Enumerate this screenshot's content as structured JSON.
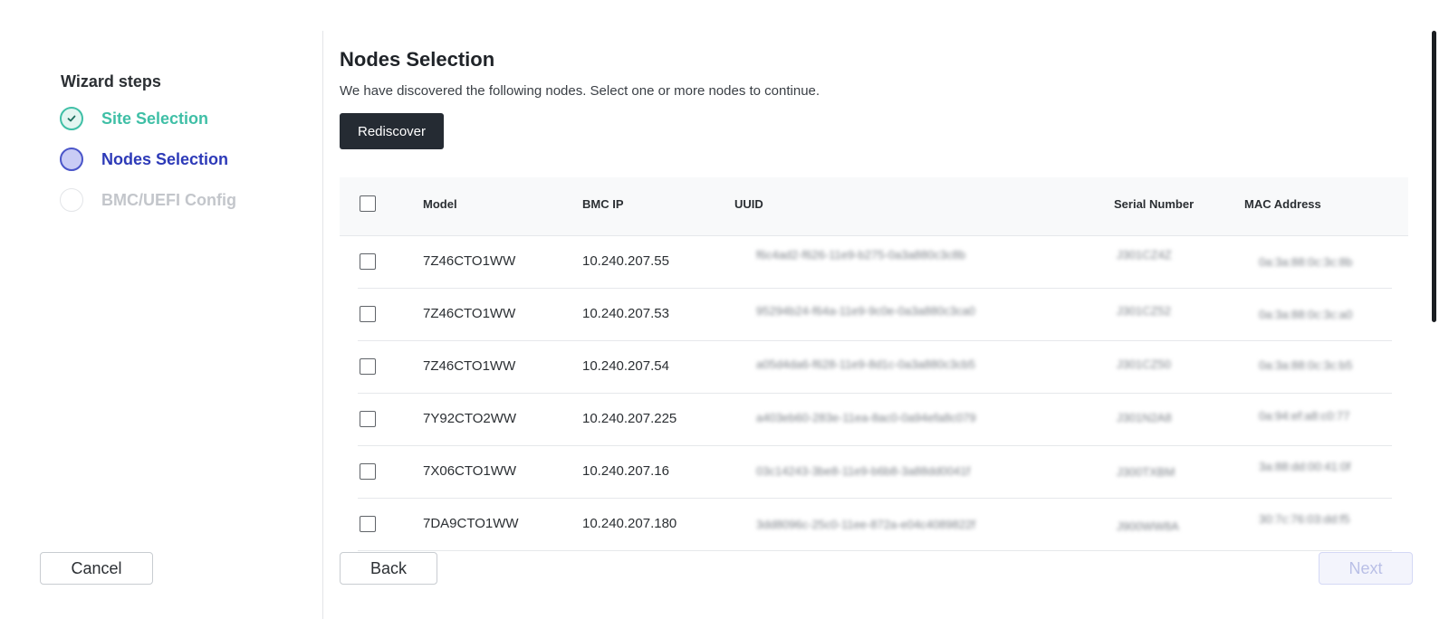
{
  "wizard": {
    "title": "Wizard steps",
    "steps": [
      {
        "label": "Site Selection",
        "status": "complete"
      },
      {
        "label": "Nodes Selection",
        "status": "current"
      },
      {
        "label": "BMC/UEFI Config",
        "status": "pending"
      }
    ]
  },
  "main": {
    "title": "Nodes Selection",
    "description": "We have discovered the following nodes. Select one or more nodes to continue.",
    "rediscover_label": "Rediscover"
  },
  "table": {
    "columns": [
      "Model",
      "BMC IP",
      "UUID",
      "Serial Number",
      "MAC Address"
    ],
    "rows": [
      {
        "model": "7Z46CTO1WW",
        "bmc_ip": "10.240.207.55",
        "uuid": "f6c4ad2-f626-11e9-b275-0a3a880c3c8b",
        "serial": "J301CZ4Z",
        "mac": "0a:3a:88:0c:3c:8b",
        "checked": false
      },
      {
        "model": "7Z46CTO1WW",
        "bmc_ip": "10.240.207.53",
        "uuid": "95294b24-f64a-11e9-9c0e-0a3a880c3ca0",
        "serial": "J301CZ52",
        "mac": "0a:3a:88:0c:3c:a0",
        "checked": false
      },
      {
        "model": "7Z46CTO1WW",
        "bmc_ip": "10.240.207.54",
        "uuid": "a05d4da6-f628-11e9-8d1c-0a3a880c3cb5",
        "serial": "J301CZ50",
        "mac": "0a:3a:88:0c:3c:b5",
        "checked": false
      },
      {
        "model": "7Y92CTO2WW",
        "bmc_ip": "10.240.207.225",
        "uuid": "a403eb60-283e-11ea-8ac0-0a94efa8c079",
        "serial": "J301N2A8",
        "mac": "0a:94:ef:a8:c0:77",
        "checked": false
      },
      {
        "model": "7X06CTO1WW",
        "bmc_ip": "10.240.207.16",
        "uuid": "03c14243-3be8-11e9-b6b8-3a88dd0041f",
        "serial": "J300TXBM",
        "mac": "3a:88:dd:00:41:0f",
        "checked": false
      },
      {
        "model": "7DA9CTO1WW",
        "bmc_ip": "10.240.207.180",
        "uuid": "3dd8096c-25c0-11ee-872a-e04c4089822f",
        "serial": "J900WW8A",
        "mac": "30:7c:76:03:dd:f5",
        "checked": false
      }
    ]
  },
  "footer": {
    "cancel_label": "Cancel",
    "back_label": "Back",
    "next_label": "Next"
  },
  "colors": {
    "step_complete": "#3fbfa6",
    "step_current": "#2d3ab8",
    "step_pending": "#c3c6cb",
    "primary_dark": "#252b33"
  },
  "icons": {
    "step_complete": "check-icon"
  }
}
